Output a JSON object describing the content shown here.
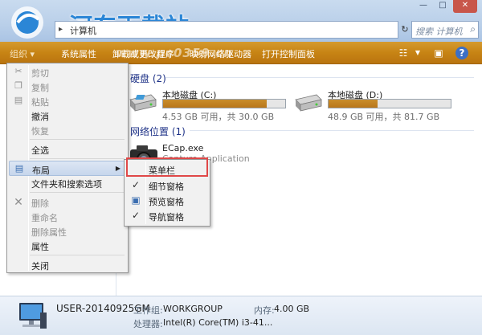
{
  "watermark": {
    "site_name": "河东下载站",
    "url": "www.pc0359.cn"
  },
  "window": {
    "minimize": "—",
    "maximize": "□",
    "close": "✕"
  },
  "address_bar": {
    "path": "计算机",
    "search_placeholder": "搜索 计算机"
  },
  "toolbar": {
    "items": [
      "系统属性",
      "卸载或更改程序",
      "映射网络驱动器",
      "打开控制面板"
    ],
    "icons": [
      "view-icon",
      "preview-pane-icon",
      "help-icon"
    ]
  },
  "groups": {
    "hard_disks": "硬盘 (2)",
    "network_locations": "网络位置 (1)"
  },
  "drives": [
    {
      "name": "本地磁盘 (C:)",
      "free_text": "4.53 GB 可用，共 30.0 GB",
      "used_fraction": 0.85
    },
    {
      "name": "本地磁盘 (D:)",
      "free_text": "48.9 GB 可用，共 81.7 GB",
      "used_fraction": 0.4
    }
  ],
  "network_item": {
    "name": "ECap.exe",
    "description": "Capture Application"
  },
  "context_menu": {
    "items": [
      {
        "label": "剪切",
        "disabled": true,
        "icon": "scissors-icon"
      },
      {
        "label": "复制",
        "disabled": true,
        "icon": "copy-icon"
      },
      {
        "label": "粘贴",
        "disabled": true,
        "icon": "paste-icon"
      },
      {
        "label": "撤消",
        "disabled": false,
        "icon": ""
      },
      {
        "label": "恢复",
        "disabled": true,
        "icon": ""
      },
      {
        "label": "全选",
        "disabled": false,
        "icon": ""
      },
      {
        "label": "布局",
        "disabled": false,
        "icon": "layout-icon",
        "has_submenu": true,
        "highlighted": true
      },
      {
        "label": "文件夹和搜索选项",
        "disabled": false,
        "icon": ""
      },
      {
        "label": "删除",
        "disabled": true,
        "icon": "delete-icon"
      },
      {
        "label": "重命名",
        "disabled": true,
        "icon": ""
      },
      {
        "label": "删除属性",
        "disabled": true,
        "icon": ""
      },
      {
        "label": "属性",
        "disabled": false,
        "icon": ""
      },
      {
        "label": "关闭",
        "disabled": false,
        "icon": ""
      }
    ]
  },
  "submenu": {
    "items": [
      {
        "label": "菜单栏",
        "checked": false
      },
      {
        "label": "细节窗格",
        "checked": true
      },
      {
        "label": "预览窗格",
        "checked": false
      },
      {
        "label": "导航窗格",
        "checked": true
      }
    ]
  },
  "details_pane": {
    "computer_name": "USER-20140925GM",
    "workgroup_label": "工作组:",
    "workgroup_value": "WORKGROUP",
    "memory_label": "内存:",
    "memory_value": "4.00 GB",
    "processor_label": "处理器:",
    "processor_value": "Intel(R) Core(TM) i3-41..."
  },
  "colors": {
    "toolbar": "#c78414",
    "highlight": "#c6d6ec",
    "callout": "#e04848",
    "drive_fill": "#c98d2d"
  }
}
